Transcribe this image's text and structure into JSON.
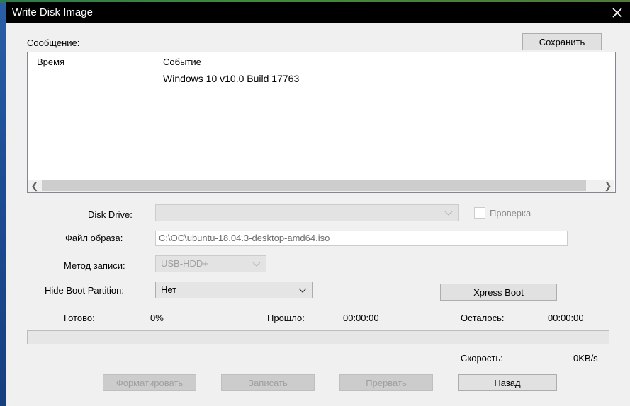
{
  "window": {
    "title": "Write Disk Image"
  },
  "messages": {
    "label": "Сообщение:",
    "save_button": "Сохранить",
    "columns": [
      "Время",
      "Событие"
    ],
    "rows": [
      {
        "time": "",
        "event": "Windows 10 v10.0 Build 17763"
      }
    ]
  },
  "form": {
    "disk_drive_label": "Disk Drive:",
    "disk_drive_value": "",
    "verify_label": "Проверка",
    "verify_checked": false,
    "image_file_label": "Файл образа:",
    "image_file_value": "C:\\OC\\ubuntu-18.04.3-desktop-amd64.iso",
    "write_method_label": "Метод записи:",
    "write_method_value": "USB-HDD+",
    "hide_boot_label": "Hide Boot Partition:",
    "hide_boot_value": "Нет",
    "xpress_boot_button": "Xpress Boot"
  },
  "status": {
    "ready_label": "Готово:",
    "ready_value": "0%",
    "elapsed_label": "Прошло:",
    "elapsed_value": "00:00:00",
    "remaining_label": "Осталось:",
    "remaining_value": "00:00:00",
    "speed_label": "Скорость:",
    "speed_value": "0KB/s",
    "progress_fraction": 0
  },
  "buttons": {
    "format": "Форматировать",
    "write": "Записать",
    "abort": "Прервать",
    "back": "Назад"
  },
  "icons": {
    "close": "close-icon",
    "dropdown": "chevron-down-icon",
    "scroll_left": "chevron-left-icon",
    "scroll_right": "chevron-right-icon"
  }
}
